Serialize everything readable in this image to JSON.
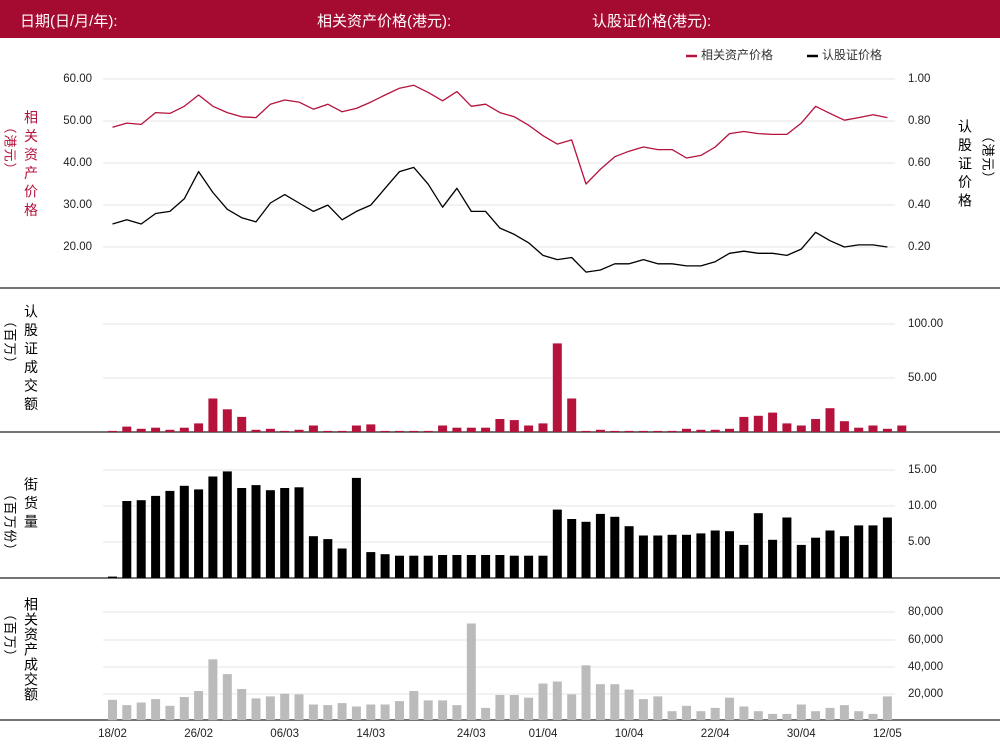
{
  "header": {
    "date_label": "日期(日/月/年):",
    "asset_label": "相关资产价格(港元):",
    "warrant_label": "认股证价格(港元):"
  },
  "colors": {
    "brand": "#a50a30",
    "asset_series": "#b5123c",
    "warrant_series": "#000000",
    "asset_turnover": "#bbbbbb"
  },
  "chart_data": [
    {
      "type": "line",
      "panel": "price",
      "legend_position": "top-right",
      "grid": true,
      "left_axis": {
        "label": "相关资产价格（港元）",
        "ticks": [
          "60.00",
          "50.00",
          "40.00",
          "30.00",
          "20.00"
        ],
        "ylim": [
          15,
          62
        ]
      },
      "right_axis": {
        "label": "认股证价格（港元）",
        "ticks": [
          "1.00",
          "0.80",
          "0.60",
          "0.40",
          "0.20"
        ],
        "ylim": [
          0.1,
          1.04
        ]
      },
      "series": [
        {
          "name": "相关资产价格",
          "axis": "left",
          "values": [
            48.5,
            49.5,
            49.2,
            52,
            51.8,
            53.5,
            56.2,
            53.5,
            52,
            51,
            50.8,
            54,
            55,
            54.5,
            52.8,
            54,
            52.2,
            53,
            54.5,
            56.2,
            57.8,
            58.5,
            56.8,
            54.8,
            57,
            53.5,
            54,
            52,
            51,
            49,
            46.5,
            44.5,
            45.5,
            35,
            38.5,
            41.5,
            42.8,
            43.8,
            43.2,
            43.2,
            41.2,
            41.8,
            43.8,
            47,
            47.5,
            47,
            46.8,
            46.8,
            49.5,
            53.5,
            51.8,
            50.2,
            50.8,
            51.5,
            50.8
          ]
        },
        {
          "name": "认股证价格",
          "axis": "right",
          "values": [
            0.31,
            0.33,
            0.31,
            0.36,
            0.37,
            0.43,
            0.56,
            0.46,
            0.38,
            0.34,
            0.32,
            0.41,
            0.45,
            0.41,
            0.37,
            0.4,
            0.33,
            0.37,
            0.4,
            0.48,
            0.56,
            0.58,
            0.5,
            0.39,
            0.48,
            0.37,
            0.37,
            0.29,
            0.26,
            0.22,
            0.16,
            0.14,
            0.15,
            0.08,
            0.09,
            0.12,
            0.12,
            0.14,
            0.12,
            0.12,
            0.11,
            0.11,
            0.13,
            0.17,
            0.18,
            0.17,
            0.17,
            0.16,
            0.19,
            0.27,
            0.23,
            0.2,
            0.21,
            0.21,
            0.2
          ]
        }
      ]
    },
    {
      "type": "bar",
      "panel": "warrant_turnover",
      "axis_label": "认股证成交额（百万）",
      "ticks": [
        "100.00",
        "50.00"
      ],
      "ylim": [
        0,
        120
      ],
      "values": [
        1,
        5,
        3,
        4,
        2,
        4,
        8,
        31,
        21,
        14,
        2,
        3,
        1,
        2,
        6,
        1,
        1,
        6,
        7,
        1,
        1,
        1,
        1,
        6,
        4,
        4,
        4,
        12,
        11,
        6,
        8,
        82,
        31,
        1,
        2,
        1,
        1,
        1,
        1,
        1,
        3,
        2,
        2,
        3,
        14,
        15,
        18,
        8,
        6,
        12,
        22,
        10,
        4,
        6,
        3,
        6
      ]
    },
    {
      "type": "bar",
      "panel": "street_stock",
      "axis_label": "街货量（百万份）",
      "ticks": [
        "15.00",
        "10.00",
        "5.00"
      ],
      "ylim": [
        0,
        17.2
      ],
      "values": [
        0.2,
        10.7,
        10.8,
        11.4,
        12.1,
        12.8,
        12.3,
        14.1,
        14.8,
        12.5,
        12.9,
        12.2,
        12.5,
        12.6,
        5.8,
        5.4,
        4.1,
        13.9,
        3.6,
        3.3,
        3.1,
        3.1,
        3.1,
        3.2,
        3.2,
        3.2,
        3.2,
        3.2,
        3.1,
        3.1,
        3.1,
        9.5,
        8.2,
        7.8,
        8.9,
        8.5,
        7.2,
        5.9,
        5.9,
        6.0,
        6.0,
        6.2,
        6.6,
        6.5,
        4.6,
        9.0,
        5.3,
        8.4,
        4.6,
        5.6,
        6.6,
        5.8,
        7.3,
        7.3,
        8.4
      ]
    },
    {
      "type": "bar",
      "panel": "asset_turnover",
      "axis_label": "相关资产成交额（百万）",
      "ticks": [
        "80,000",
        "60,000",
        "40,000",
        "20,000"
      ],
      "ylim": [
        0,
        88000
      ],
      "x_ticks": [
        "18/02",
        "26/02",
        "06/03",
        "14/03",
        "24/03",
        "01/04",
        "10/04",
        "22/04",
        "30/04",
        "12/05"
      ],
      "values": [
        15000,
        11000,
        13000,
        15500,
        10500,
        17000,
        21500,
        45000,
        34000,
        23000,
        16000,
        17500,
        19500,
        19000,
        11500,
        11000,
        12500,
        10000,
        11500,
        11500,
        14000,
        21500,
        14500,
        14500,
        11000,
        71500,
        9000,
        18500,
        18500,
        16500,
        27000,
        28500,
        19000,
        40500,
        26500,
        26500,
        22500,
        15500,
        17500,
        6500,
        10500,
        6500,
        9000,
        16500,
        10000,
        6500,
        4500,
        4500,
        11500,
        6500,
        9000,
        11000,
        6500,
        4500,
        17500
      ]
    }
  ]
}
